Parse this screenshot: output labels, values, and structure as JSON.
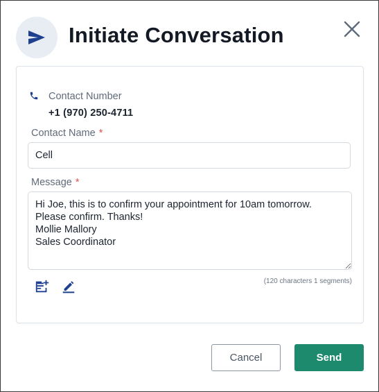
{
  "dialog": {
    "title": "Initiate Conversation",
    "colors": {
      "accent": "#1f3f8f",
      "primary_button": "#1e8a6d",
      "required": "#d9534f"
    }
  },
  "contact": {
    "number_label": "Contact Number",
    "number_value": "+1 (970) 250-4711",
    "name_label": "Contact Name",
    "name_value": "Cell",
    "required_marker": "*"
  },
  "message": {
    "label": "Message",
    "required_marker": "*",
    "value": "Hi Joe, this is to confirm your appointment for 10am tomorrow.\nPlease confirm. Thanks!\nMollie Mallory\nSales Coordinator",
    "char_count": "(120 characters 1 segments)"
  },
  "icons": {
    "header": "send-icon",
    "close": "close-icon",
    "phone": "phone-icon",
    "template": "add-template-icon",
    "signature": "edit-signature-icon"
  },
  "footer": {
    "cancel_label": "Cancel",
    "send_label": "Send"
  }
}
